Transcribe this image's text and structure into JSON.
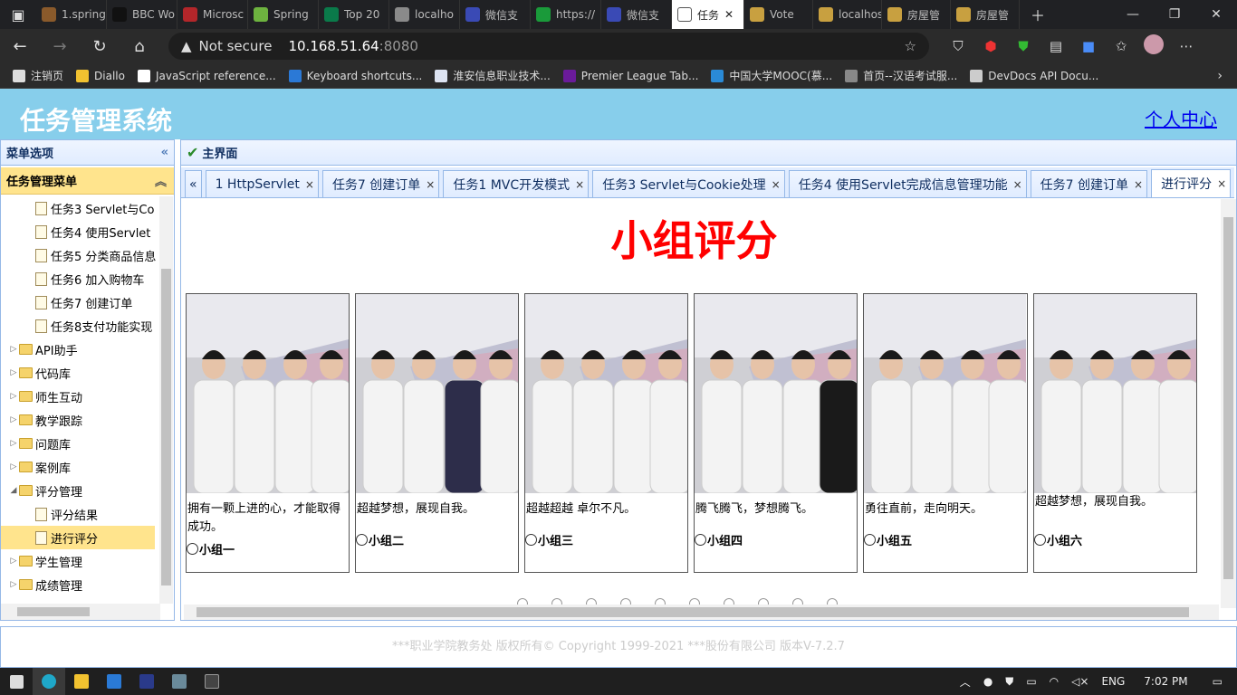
{
  "browser": {
    "tabs": [
      {
        "label": "1.spring",
        "color": "#8a5a2b"
      },
      {
        "label": "BBC Wo",
        "color": "#111111"
      },
      {
        "label": "Microsc",
        "color": "#b3262a"
      },
      {
        "label": "Spring",
        "color": "#6db33f"
      },
      {
        "label": "Top 20",
        "color": "#0a7a4a"
      },
      {
        "label": "localho",
        "color": "#8a8a8a"
      },
      {
        "label": "微信支",
        "color": "#3a4ab5"
      },
      {
        "label": "https://",
        "color": "#1a9a3a"
      },
      {
        "label": "微信支",
        "color": "#3a4ab5"
      },
      {
        "label": "任务",
        "color": "#ffffff"
      },
      {
        "label": "Vote",
        "color": "#c8a040"
      },
      {
        "label": "localhos",
        "color": "#c8a040"
      },
      {
        "label": "房屋管",
        "color": "#c8a040"
      },
      {
        "label": "房屋管",
        "color": "#c8a040"
      }
    ],
    "address": {
      "security": "Not secure",
      "host": "10.168.51.64",
      "port": ":8080"
    },
    "bookmarks": [
      {
        "label": "注销页",
        "color": "#dddddd"
      },
      {
        "label": "Diallo",
        "color": "#f2c230"
      },
      {
        "label": "JavaScript reference...",
        "color": "#ffffff"
      },
      {
        "label": "Keyboard shortcuts...",
        "color": "#2b79d6"
      },
      {
        "label": "淮安信息职业技术...",
        "color": "#dde4f2"
      },
      {
        "label": "Premier League Tab...",
        "color": "#6a1b9a"
      },
      {
        "label": "中国大学MOOC(慕...",
        "color": "#2a8ad6"
      },
      {
        "label": "首页--汉语考试服...",
        "color": "#888888"
      },
      {
        "label": "DevDocs API Docu...",
        "color": "#cccccc"
      }
    ]
  },
  "app": {
    "title": "任务管理系统",
    "user_center": "个人中心",
    "sidebar": {
      "header": "菜单选项",
      "accordion": "任务管理菜单",
      "items": [
        {
          "label": "任务3 Servlet与Co",
          "type": "file",
          "indent": 1
        },
        {
          "label": "任务4 使用Servlet",
          "type": "file",
          "indent": 1
        },
        {
          "label": "任务5 分类商品信息",
          "type": "file",
          "indent": 1
        },
        {
          "label": "任务6 加入购物车",
          "type": "file",
          "indent": 1
        },
        {
          "label": "任务7 创建订单",
          "type": "file",
          "indent": 1
        },
        {
          "label": "任务8支付功能实现",
          "type": "file",
          "indent": 1
        },
        {
          "label": "API助手",
          "type": "folder",
          "indent": 0
        },
        {
          "label": "代码库",
          "type": "folder",
          "indent": 0
        },
        {
          "label": "师生互动",
          "type": "folder",
          "indent": 0
        },
        {
          "label": "教学跟踪",
          "type": "folder",
          "indent": 0
        },
        {
          "label": "问题库",
          "type": "folder",
          "indent": 0
        },
        {
          "label": "案例库",
          "type": "folder",
          "indent": 0
        },
        {
          "label": "评分管理",
          "type": "folder-open",
          "indent": 0
        },
        {
          "label": "评分结果",
          "type": "file",
          "indent": 1
        },
        {
          "label": "进行评分",
          "type": "file",
          "indent": 1,
          "selected": true
        },
        {
          "label": "学生管理",
          "type": "folder",
          "indent": 0
        },
        {
          "label": "成绩管理",
          "type": "folder",
          "indent": 0
        }
      ]
    },
    "main": {
      "header": "主界面",
      "tabs": [
        {
          "label": "1 HttpServlet"
        },
        {
          "label": "任务7 创建订单"
        },
        {
          "label": "任务1 MVC开发模式"
        },
        {
          "label": "任务3 Servlet与Cookie处理"
        },
        {
          "label": "任务4 使用Servlet完成信息管理功能"
        },
        {
          "label": "任务7 创建订单"
        },
        {
          "label": "进行评分",
          "active": true
        }
      ],
      "heading": "小组评分",
      "groups": [
        {
          "motto": "拥有一颗上进的心，才能取得成功。",
          "name": "小组一"
        },
        {
          "motto": "超越梦想，展现自我。",
          "name": "小组二"
        },
        {
          "motto": "超越超越 卓尔不凡。",
          "name": "小组三"
        },
        {
          "motto": "腾飞腾飞，梦想腾飞。",
          "name": "小组四"
        },
        {
          "motto": "勇往直前，走向明天。",
          "name": "小组五"
        },
        {
          "motto": "超越梦想，展现自我。",
          "name": "小组六"
        }
      ]
    },
    "footer": "***职业学院教务处 版权所有© Copyright 1999-2021 ***股份有限公司 版本V-7.2.7"
  },
  "taskbar": {
    "lang": "ENG",
    "time": "7:02 PM"
  },
  "colors": {
    "header_bg": "#87ceeb",
    "heading": "#ff0000",
    "selected": "#ffe48d",
    "panel_border": "#95b8e7"
  }
}
